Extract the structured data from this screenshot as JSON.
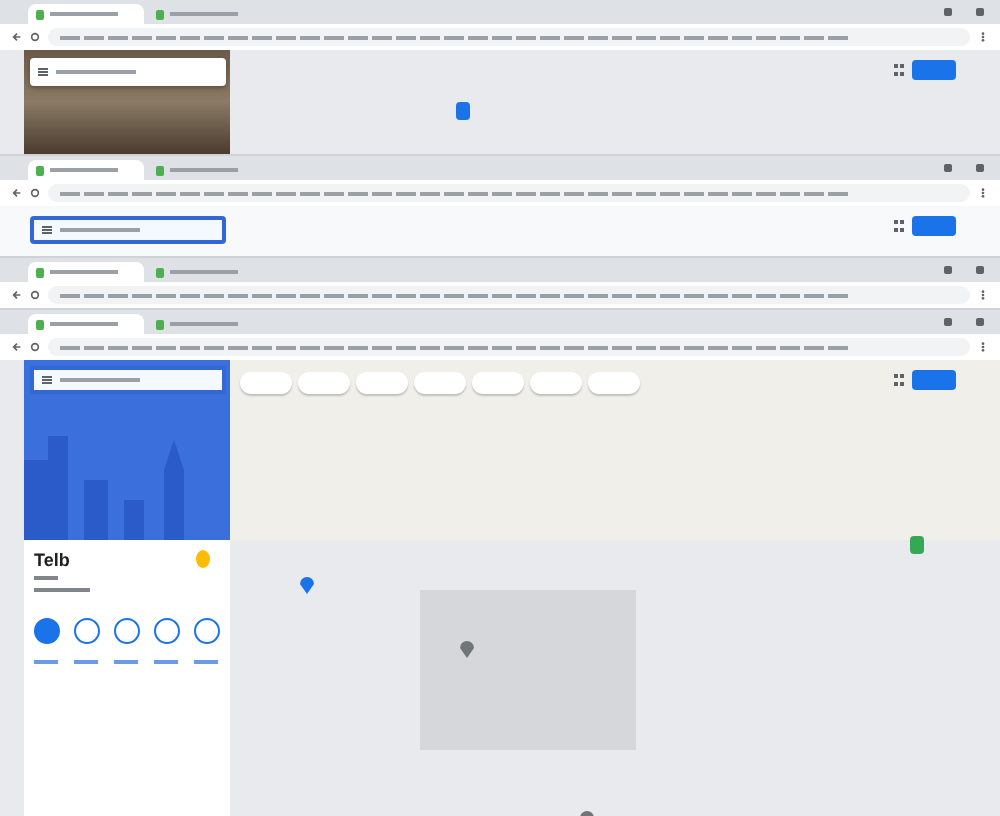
{
  "windows": [
    {
      "kind": "photo-search",
      "tabs": [
        {
          "selected": true
        },
        {
          "selected": false
        }
      ],
      "search_focused": false
    },
    {
      "kind": "search-only",
      "tabs": [
        {
          "selected": true
        },
        {
          "selected": false
        }
      ],
      "search_focused": true
    },
    {
      "kind": "collapsed",
      "tabs": [
        {
          "selected": true
        },
        {
          "selected": false
        }
      ]
    },
    {
      "kind": "place",
      "tabs": [
        {
          "selected": true
        },
        {
          "selected": false
        }
      ],
      "search_focused": true,
      "place": {
        "title": "Telb",
        "actions": [
          {
            "selected": true
          },
          {
            "selected": false
          },
          {
            "selected": false
          },
          {
            "selected": false
          },
          {
            "selected": false
          }
        ]
      }
    }
  ]
}
